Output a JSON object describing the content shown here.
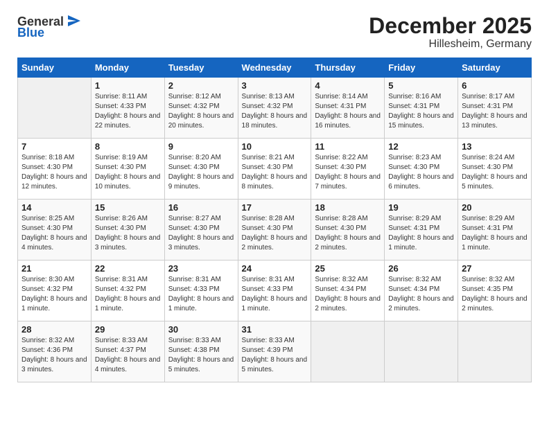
{
  "logo": {
    "general": "General",
    "blue": "Blue"
  },
  "title": "December 2025",
  "subtitle": "Hillesheim, Germany",
  "calendar": {
    "headers": [
      "Sunday",
      "Monday",
      "Tuesday",
      "Wednesday",
      "Thursday",
      "Friday",
      "Saturday"
    ],
    "weeks": [
      [
        {
          "day": "",
          "sunrise": "",
          "sunset": "",
          "daylight": "",
          "empty": true
        },
        {
          "day": "1",
          "sunrise": "Sunrise: 8:11 AM",
          "sunset": "Sunset: 4:33 PM",
          "daylight": "Daylight: 8 hours and 22 minutes."
        },
        {
          "day": "2",
          "sunrise": "Sunrise: 8:12 AM",
          "sunset": "Sunset: 4:32 PM",
          "daylight": "Daylight: 8 hours and 20 minutes."
        },
        {
          "day": "3",
          "sunrise": "Sunrise: 8:13 AM",
          "sunset": "Sunset: 4:32 PM",
          "daylight": "Daylight: 8 hours and 18 minutes."
        },
        {
          "day": "4",
          "sunrise": "Sunrise: 8:14 AM",
          "sunset": "Sunset: 4:31 PM",
          "daylight": "Daylight: 8 hours and 16 minutes."
        },
        {
          "day": "5",
          "sunrise": "Sunrise: 8:16 AM",
          "sunset": "Sunset: 4:31 PM",
          "daylight": "Daylight: 8 hours and 15 minutes."
        },
        {
          "day": "6",
          "sunrise": "Sunrise: 8:17 AM",
          "sunset": "Sunset: 4:31 PM",
          "daylight": "Daylight: 8 hours and 13 minutes."
        }
      ],
      [
        {
          "day": "7",
          "sunrise": "Sunrise: 8:18 AM",
          "sunset": "Sunset: 4:30 PM",
          "daylight": "Daylight: 8 hours and 12 minutes."
        },
        {
          "day": "8",
          "sunrise": "Sunrise: 8:19 AM",
          "sunset": "Sunset: 4:30 PM",
          "daylight": "Daylight: 8 hours and 10 minutes."
        },
        {
          "day": "9",
          "sunrise": "Sunrise: 8:20 AM",
          "sunset": "Sunset: 4:30 PM",
          "daylight": "Daylight: 8 hours and 9 minutes."
        },
        {
          "day": "10",
          "sunrise": "Sunrise: 8:21 AM",
          "sunset": "Sunset: 4:30 PM",
          "daylight": "Daylight: 8 hours and 8 minutes."
        },
        {
          "day": "11",
          "sunrise": "Sunrise: 8:22 AM",
          "sunset": "Sunset: 4:30 PM",
          "daylight": "Daylight: 8 hours and 7 minutes."
        },
        {
          "day": "12",
          "sunrise": "Sunrise: 8:23 AM",
          "sunset": "Sunset: 4:30 PM",
          "daylight": "Daylight: 8 hours and 6 minutes."
        },
        {
          "day": "13",
          "sunrise": "Sunrise: 8:24 AM",
          "sunset": "Sunset: 4:30 PM",
          "daylight": "Daylight: 8 hours and 5 minutes."
        }
      ],
      [
        {
          "day": "14",
          "sunrise": "Sunrise: 8:25 AM",
          "sunset": "Sunset: 4:30 PM",
          "daylight": "Daylight: 8 hours and 4 minutes."
        },
        {
          "day": "15",
          "sunrise": "Sunrise: 8:26 AM",
          "sunset": "Sunset: 4:30 PM",
          "daylight": "Daylight: 8 hours and 3 minutes."
        },
        {
          "day": "16",
          "sunrise": "Sunrise: 8:27 AM",
          "sunset": "Sunset: 4:30 PM",
          "daylight": "Daylight: 8 hours and 3 minutes."
        },
        {
          "day": "17",
          "sunrise": "Sunrise: 8:28 AM",
          "sunset": "Sunset: 4:30 PM",
          "daylight": "Daylight: 8 hours and 2 minutes."
        },
        {
          "day": "18",
          "sunrise": "Sunrise: 8:28 AM",
          "sunset": "Sunset: 4:30 PM",
          "daylight": "Daylight: 8 hours and 2 minutes."
        },
        {
          "day": "19",
          "sunrise": "Sunrise: 8:29 AM",
          "sunset": "Sunset: 4:31 PM",
          "daylight": "Daylight: 8 hours and 1 minute."
        },
        {
          "day": "20",
          "sunrise": "Sunrise: 8:29 AM",
          "sunset": "Sunset: 4:31 PM",
          "daylight": "Daylight: 8 hours and 1 minute."
        }
      ],
      [
        {
          "day": "21",
          "sunrise": "Sunrise: 8:30 AM",
          "sunset": "Sunset: 4:32 PM",
          "daylight": "Daylight: 8 hours and 1 minute."
        },
        {
          "day": "22",
          "sunrise": "Sunrise: 8:31 AM",
          "sunset": "Sunset: 4:32 PM",
          "daylight": "Daylight: 8 hours and 1 minute."
        },
        {
          "day": "23",
          "sunrise": "Sunrise: 8:31 AM",
          "sunset": "Sunset: 4:33 PM",
          "daylight": "Daylight: 8 hours and 1 minute."
        },
        {
          "day": "24",
          "sunrise": "Sunrise: 8:31 AM",
          "sunset": "Sunset: 4:33 PM",
          "daylight": "Daylight: 8 hours and 1 minute."
        },
        {
          "day": "25",
          "sunrise": "Sunrise: 8:32 AM",
          "sunset": "Sunset: 4:34 PM",
          "daylight": "Daylight: 8 hours and 2 minutes."
        },
        {
          "day": "26",
          "sunrise": "Sunrise: 8:32 AM",
          "sunset": "Sunset: 4:34 PM",
          "daylight": "Daylight: 8 hours and 2 minutes."
        },
        {
          "day": "27",
          "sunrise": "Sunrise: 8:32 AM",
          "sunset": "Sunset: 4:35 PM",
          "daylight": "Daylight: 8 hours and 2 minutes."
        }
      ],
      [
        {
          "day": "28",
          "sunrise": "Sunrise: 8:32 AM",
          "sunset": "Sunset: 4:36 PM",
          "daylight": "Daylight: 8 hours and 3 minutes."
        },
        {
          "day": "29",
          "sunrise": "Sunrise: 8:33 AM",
          "sunset": "Sunset: 4:37 PM",
          "daylight": "Daylight: 8 hours and 4 minutes."
        },
        {
          "day": "30",
          "sunrise": "Sunrise: 8:33 AM",
          "sunset": "Sunset: 4:38 PM",
          "daylight": "Daylight: 8 hours and 5 minutes."
        },
        {
          "day": "31",
          "sunrise": "Sunrise: 8:33 AM",
          "sunset": "Sunset: 4:39 PM",
          "daylight": "Daylight: 8 hours and 5 minutes."
        },
        {
          "day": "",
          "sunrise": "",
          "sunset": "",
          "daylight": "",
          "empty": true
        },
        {
          "day": "",
          "sunrise": "",
          "sunset": "",
          "daylight": "",
          "empty": true
        },
        {
          "day": "",
          "sunrise": "",
          "sunset": "",
          "daylight": "",
          "empty": true
        }
      ]
    ]
  }
}
